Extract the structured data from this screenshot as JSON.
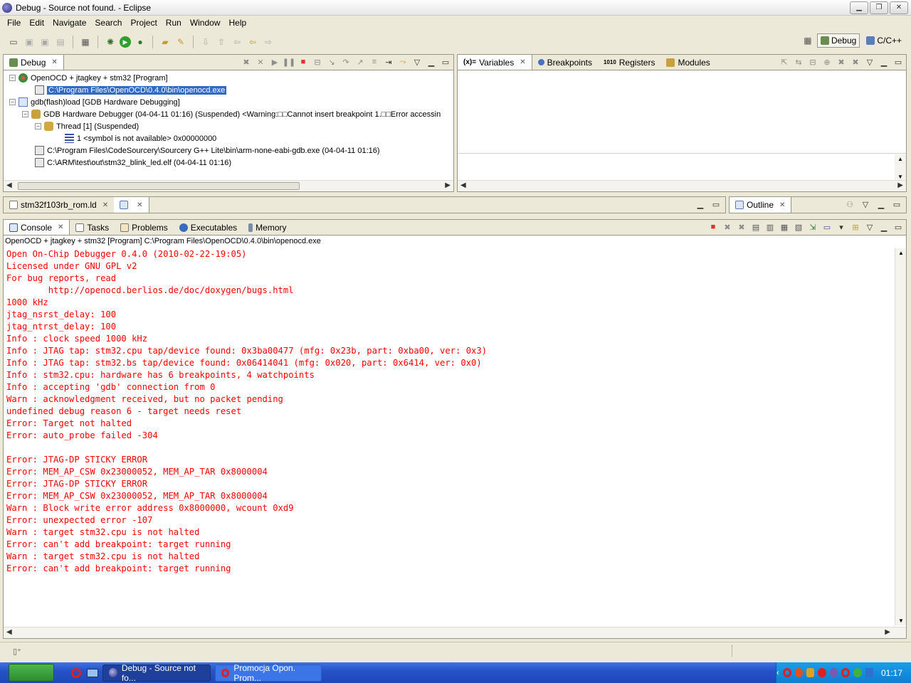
{
  "window": {
    "title": "Debug - Source not found. - Eclipse"
  },
  "menu": [
    "File",
    "Edit",
    "Navigate",
    "Search",
    "Project",
    "Run",
    "Window",
    "Help"
  ],
  "perspectives": [
    {
      "label": "Debug",
      "icon": "debug-perspective-icon",
      "active": true
    },
    {
      "label": "C/C++",
      "icon": "cpp-perspective-icon",
      "active": false
    }
  ],
  "debug_view": {
    "tab": "Debug",
    "tree": [
      {
        "label": "OpenOCD + jtagkey + stm32 [Program]",
        "indent": 0,
        "toggle": "−",
        "icon": "launch-icon"
      },
      {
        "label": "C:\\Program Files\\OpenOCD\\0.4.0\\bin\\openocd.exe",
        "indent": 1,
        "toggle": "",
        "icon": "process-icon",
        "selected": true
      },
      {
        "label": "gdb(flash)load [GDB Hardware Debugging]",
        "indent": 0,
        "toggle": "−",
        "icon": "c-launch-icon"
      },
      {
        "label": "GDB Hardware Debugger (04-04-11 01:16) (Suspended) <Warning:□□Cannot insert breakpoint 1.□□Error accessin",
        "indent": 1,
        "toggle": "−",
        "icon": "debugger-icon"
      },
      {
        "label": "Thread [1] (Suspended)",
        "indent": 2,
        "toggle": "−",
        "icon": "thread-icon"
      },
      {
        "label": "1 <symbol is not available> 0x00000000",
        "indent": 3,
        "toggle": "",
        "icon": "stack-frame-icon"
      },
      {
        "label": "C:\\Program Files\\CodeSourcery\\Sourcery G++ Lite\\bin\\arm-none-eabi-gdb.exe (04-04-11 01:16)",
        "indent": 1,
        "toggle": "",
        "icon": "process-icon"
      },
      {
        "label": "C:\\ARM\\test\\out\\stm32_blink_led.elf (04-04-11 01:16)",
        "indent": 1,
        "toggle": "",
        "icon": "process-icon"
      }
    ]
  },
  "variables_view": {
    "tabs": [
      {
        "label": "Variables",
        "icon": "variables-icon",
        "active": true
      },
      {
        "label": "Breakpoints",
        "icon": "breakpoints-icon",
        "active": false
      },
      {
        "label": "Registers",
        "icon": "registers-icon",
        "active": false
      },
      {
        "label": "Modules",
        "icon": "modules-icon",
        "active": false
      }
    ]
  },
  "editor": {
    "tabs": [
      {
        "label": "stm32f103rb_rom.ld",
        "icon": "file-icon",
        "active": false
      },
      {
        "label": "",
        "icon": "c-file-icon",
        "active": true
      }
    ]
  },
  "outline": {
    "tab": "Outline"
  },
  "console_view": {
    "tabs": [
      {
        "label": "Console",
        "icon": "console-icon",
        "active": true
      },
      {
        "label": "Tasks",
        "icon": "tasks-icon",
        "active": false
      },
      {
        "label": "Problems",
        "icon": "problems-icon",
        "active": false
      },
      {
        "label": "Executables",
        "icon": "executables-icon",
        "active": false
      },
      {
        "label": "Memory",
        "icon": "memory-icon",
        "active": false
      }
    ],
    "process_label": "OpenOCD + jtagkey + stm32 [Program] C:\\Program Files\\OpenOCD\\0.4.0\\bin\\openocd.exe",
    "lines": [
      "Open On-Chip Debugger 0.4.0 (2010-02-22-19:05)",
      "Licensed under GNU GPL v2",
      "For bug reports, read",
      "        http://openocd.berlios.de/doc/doxygen/bugs.html",
      "1000 kHz",
      "jtag_nsrst_delay: 100",
      "jtag_ntrst_delay: 100",
      "Info : clock speed 1000 kHz",
      "Info : JTAG tap: stm32.cpu tap/device found: 0x3ba00477 (mfg: 0x23b, part: 0xba00, ver: 0x3)",
      "Info : JTAG tap: stm32.bs tap/device found: 0x06414041 (mfg: 0x020, part: 0x6414, ver: 0x0)",
      "Info : stm32.cpu: hardware has 6 breakpoints, 4 watchpoints",
      "Info : accepting 'gdb' connection from 0",
      "Warn : acknowledgment received, but no packet pending",
      "undefined debug reason 6 - target needs reset",
      "Error: Target not halted",
      "Error: auto_probe failed -304",
      "",
      "Error: JTAG-DP STICKY ERROR",
      "Error: MEM_AP_CSW 0x23000052, MEM_AP_TAR 0x8000004",
      "Error: JTAG-DP STICKY ERROR",
      "Error: MEM_AP_CSW 0x23000052, MEM_AP_TAR 0x8000004",
      "Warn : Block write error address 0x8000000, wcount 0xd9",
      "Error: unexpected error -107",
      "Warn : target stm32.cpu is not halted",
      "Error: can't add breakpoint: target running",
      "Warn : target stm32.cpu is not halted",
      "Error: can't add breakpoint: target running"
    ]
  },
  "taskbar": {
    "tasks": [
      {
        "label": "Debug - Source not fo...",
        "icon": "eclipse-icon",
        "active": true
      },
      {
        "label": "Promocja Opon. Prom...",
        "icon": "opera-icon",
        "active": false
      }
    ],
    "clock": "01:17"
  },
  "colors": {
    "console_text": "#ff0000",
    "selection": "#316ac5",
    "taskbar": "#245edb"
  }
}
